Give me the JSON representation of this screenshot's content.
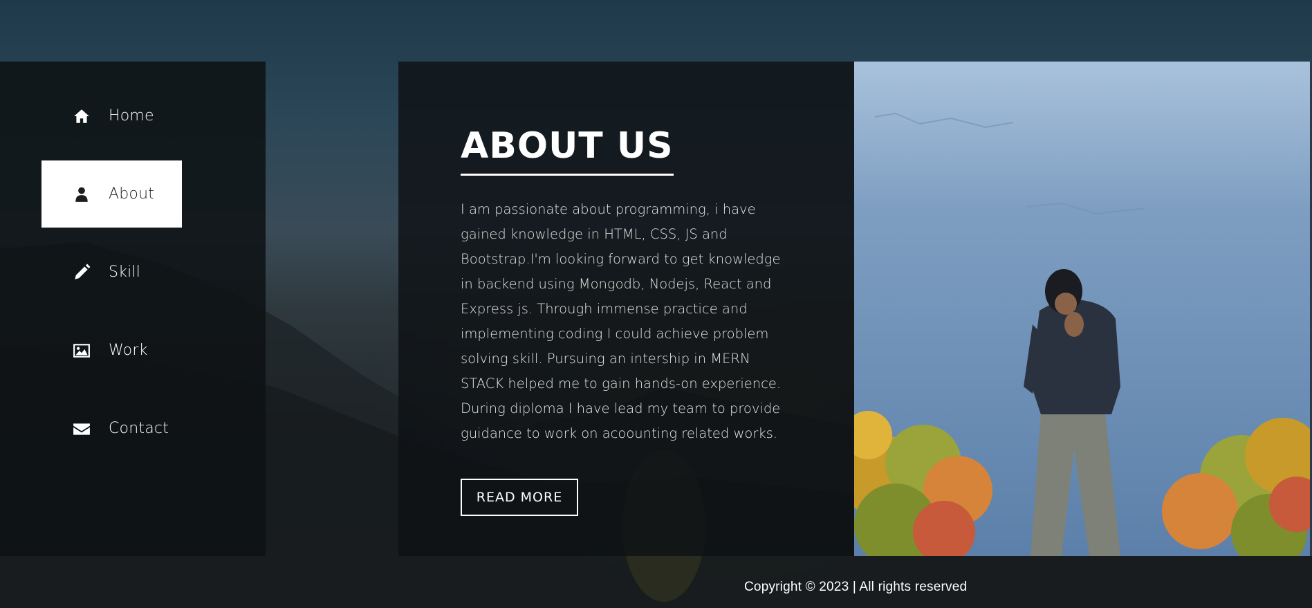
{
  "nav": {
    "items": [
      {
        "label": "Home",
        "icon": "home-icon"
      },
      {
        "label": "About",
        "icon": "user-icon"
      },
      {
        "label": "Skill",
        "icon": "pencil-icon"
      },
      {
        "label": "Work",
        "icon": "image-icon"
      },
      {
        "label": "Contact",
        "icon": "envelope-icon"
      }
    ],
    "active": "About"
  },
  "about": {
    "title": "ABOUT US",
    "text": "I am passionate about programming, i have gained knowledge in HTML, CSS, JS and Bootstrap.I'm looking forward to get knowledge in backend using Mongodb, Nodejs, React and Express js. Through immense practice and implementing coding I could achieve problem solving skill. Pursuing an intership in MERN STACK helped me to gain hands-on experience. During diploma I have lead my team to provide guidance to work on acoounting related works.",
    "button_label": "READ MORE"
  },
  "footer": {
    "copyright": "Copyright © 2023 | All rights reserved"
  },
  "colors": {
    "panel_bg": "#0e1215",
    "active_bg": "#ffffff",
    "text": "#ffffff"
  }
}
